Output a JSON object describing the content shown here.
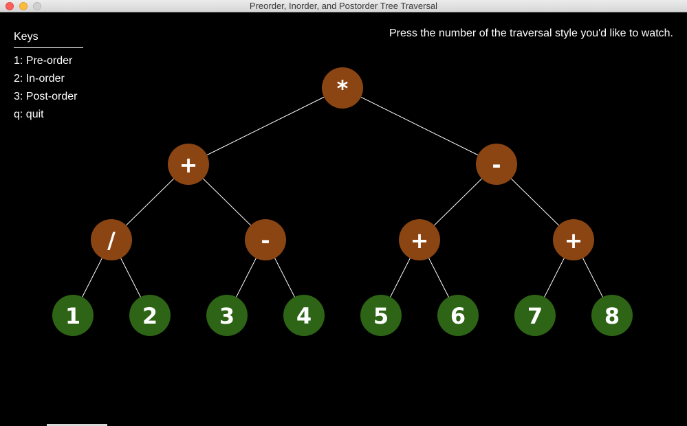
{
  "window": {
    "title": "Preorder, Inorder, and Postorder Tree Traversal"
  },
  "keys": {
    "title": "Keys",
    "items": [
      "1: Pre-order",
      "2: In-order",
      "3: Post-order",
      "q: quit"
    ]
  },
  "prompt": "Press the number of the traversal style you'd like to watch.",
  "colors": {
    "operator_node": "#8b4513",
    "leaf_node": "#2d6415",
    "edge": "#ffffff",
    "background": "#000000"
  },
  "tree": {
    "label": "*",
    "type": "operator",
    "children": [
      {
        "label": "+",
        "type": "operator",
        "children": [
          {
            "label": "/",
            "type": "operator",
            "children": [
              {
                "label": "1",
                "type": "leaf"
              },
              {
                "label": "2",
                "type": "leaf"
              }
            ]
          },
          {
            "label": "-",
            "type": "operator",
            "children": [
              {
                "label": "3",
                "type": "leaf"
              },
              {
                "label": "4",
                "type": "leaf"
              }
            ]
          }
        ]
      },
      {
        "label": "-",
        "type": "operator",
        "children": [
          {
            "label": "+",
            "type": "operator",
            "children": [
              {
                "label": "5",
                "type": "leaf"
              },
              {
                "label": "6",
                "type": "leaf"
              }
            ]
          },
          {
            "label": "+",
            "type": "operator",
            "children": [
              {
                "label": "7",
                "type": "leaf"
              },
              {
                "label": "8",
                "type": "leaf"
              }
            ]
          }
        ]
      }
    ]
  }
}
